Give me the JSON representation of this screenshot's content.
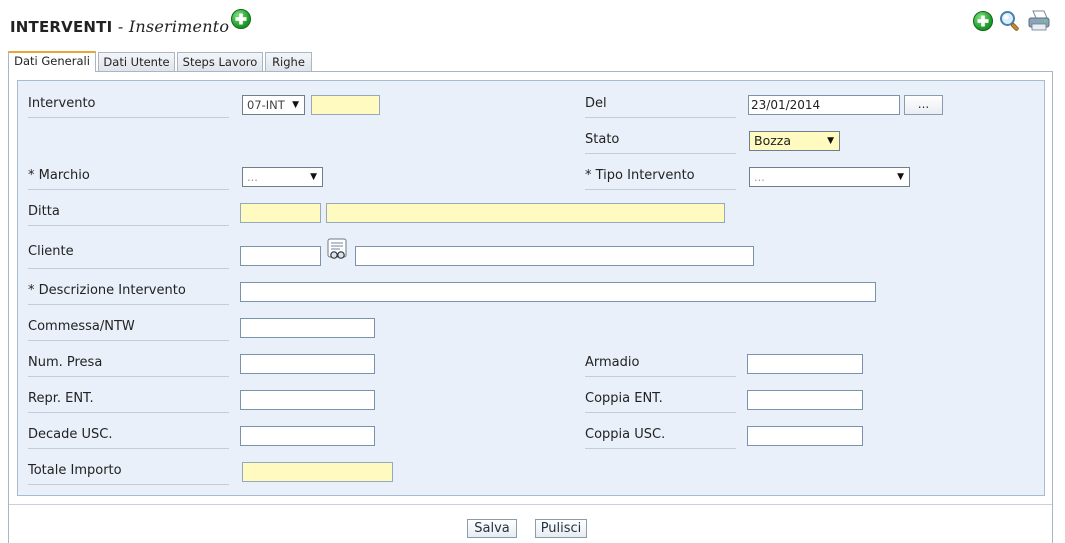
{
  "header": {
    "title": "INTERVENTI",
    "separator": "-",
    "subtitle": "Inserimento",
    "icons": [
      "add-icon",
      "search-icon",
      "print-icon"
    ]
  },
  "tabs": [
    {
      "label": "Dati Generali",
      "active": true
    },
    {
      "label": "Dati Utente",
      "active": false
    },
    {
      "label": "Steps Lavoro",
      "active": false
    },
    {
      "label": "Righe",
      "active": false
    }
  ],
  "form": {
    "intervento": {
      "label": "Intervento",
      "prefix": "07-INT",
      "number": ""
    },
    "del": {
      "label": "Del",
      "value": "23/01/2014",
      "picker_label": "..."
    },
    "stato": {
      "label": "Stato",
      "value": "Bozza"
    },
    "marchio": {
      "label": "* Marchio",
      "value": "..."
    },
    "tipo_intervento": {
      "label": "* Tipo Intervento",
      "value": "..."
    },
    "ditta": {
      "label": "Ditta",
      "code": "",
      "name": ""
    },
    "cliente": {
      "label": "Cliente",
      "code": "",
      "name": "",
      "lookup_icon": "lookup-icon"
    },
    "descrizione": {
      "label": "* Descrizione Intervento",
      "value": ""
    },
    "commessa": {
      "label": "Commessa/NTW",
      "value": ""
    },
    "num_presa": {
      "label": "Num. Presa",
      "value": ""
    },
    "armadio": {
      "label": "Armadio",
      "value": ""
    },
    "repr_ent": {
      "label": "Repr. ENT.",
      "value": ""
    },
    "coppia_ent": {
      "label": "Coppia ENT.",
      "value": ""
    },
    "decade_usc": {
      "label": "Decade USC.",
      "value": ""
    },
    "coppia_usc": {
      "label": "Coppia USC.",
      "value": ""
    },
    "totale_importo": {
      "label": "Totale Importo",
      "value": ""
    }
  },
  "actions": {
    "save": "Salva",
    "clear": "Pulisci"
  },
  "colors": {
    "panel_bg": "#eaf0fa",
    "required_bg": "#fffbc0",
    "active_tab_accent": "#e9a53a"
  }
}
